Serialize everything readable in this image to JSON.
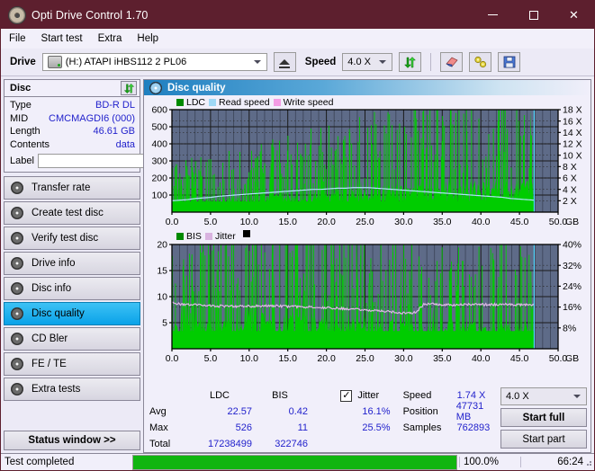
{
  "window": {
    "title": "Opti Drive Control 1.70",
    "icon": "disc-icon",
    "minimize": "minimize-icon",
    "maximize": "maximize-icon",
    "close": "close-icon"
  },
  "menu": {
    "items": [
      "File",
      "Start test",
      "Extra",
      "Help"
    ]
  },
  "toolbar": {
    "drive_label": "Drive",
    "drive_value": "(H:)   ATAPI iHBS112  2 PL06",
    "eject_icon": "eject-icon",
    "speed_label": "Speed",
    "speed_value": "4.0 X",
    "refresh_icon": "refresh-icon",
    "erase_icon": "eraser-icon",
    "tools_icon": "tools-icon",
    "save_icon": "save-icon"
  },
  "disc_panel": {
    "title": "Disc",
    "refresh_icon": "refresh-icon",
    "rows": [
      {
        "key": "Type",
        "value": "BD-R DL"
      },
      {
        "key": "MID",
        "value": "CMCMAGDI6 (000)"
      },
      {
        "key": "Length",
        "value": "46.61 GB"
      },
      {
        "key": "Contents",
        "value": "data"
      }
    ],
    "label_key": "Label",
    "label_value": "",
    "label_placeholder": "",
    "disc_icon": "disc-icon"
  },
  "nav": {
    "items": [
      {
        "label": "Transfer rate",
        "selected": false
      },
      {
        "label": "Create test disc",
        "selected": false
      },
      {
        "label": "Verify test disc",
        "selected": false
      },
      {
        "label": "Drive info",
        "selected": false
      },
      {
        "label": "Disc info",
        "selected": false
      },
      {
        "label": "Disc quality",
        "selected": true
      },
      {
        "label": "CD Bler",
        "selected": false
      },
      {
        "label": "FE / TE",
        "selected": false
      },
      {
        "label": "Extra tests",
        "selected": false
      }
    ],
    "status_window": "Status window >>"
  },
  "panel": {
    "title": "Disc quality",
    "icon": "disc-quality-icon"
  },
  "chart_data": [
    {
      "type": "area",
      "name": "top-chart",
      "title": "",
      "xlabel": "GB",
      "ylabel": "",
      "xlim": [
        0,
        50
      ],
      "ylim": [
        0,
        600
      ],
      "y2lim": [
        0,
        18
      ],
      "xticks": [
        "0.0",
        "5.0",
        "10.0",
        "15.0",
        "20.0",
        "25.0",
        "30.0",
        "35.0",
        "40.0",
        "45.0",
        "50.0"
      ],
      "yticks": [
        "100",
        "200",
        "300",
        "400",
        "500",
        "600"
      ],
      "y2ticks": [
        "2 X",
        "4 X",
        "6 X",
        "8 X",
        "10 X",
        "12 X",
        "14 X",
        "16 X",
        "18 X"
      ],
      "x_unit": "GB",
      "legend": [
        {
          "label": "LDC",
          "color": "#00a000"
        },
        {
          "label": "Read speed",
          "color": "#9fd8f5"
        },
        {
          "label": "Write speed",
          "color": "#f49ce4"
        }
      ],
      "grid": true,
      "plot_bg": "#5e6b88",
      "data_end_x": 46.9,
      "series": [
        {
          "name": "LDC",
          "color": "#00cc00",
          "type": "area-spikes",
          "baseline": [
            60,
            62,
            65,
            68,
            70,
            72,
            74,
            78,
            80,
            82,
            85,
            88,
            90,
            92,
            95,
            98,
            100,
            103,
            106,
            110,
            112,
            115,
            118,
            120,
            122,
            125,
            128,
            130,
            132,
            134,
            136,
            138,
            140,
            142,
            144,
            146,
            148,
            150,
            152,
            154,
            156,
            158,
            160,
            162,
            160,
            158,
            156
          ],
          "max_spike": 526
        },
        {
          "name": "Read speed",
          "color": "#aee4fa",
          "type": "line",
          "values": [
            2.0,
            2.1,
            2.2,
            2.4,
            2.5,
            2.6,
            2.8,
            2.9,
            3.0,
            3.1,
            3.2,
            3.3,
            3.4,
            3.5,
            3.6,
            3.7,
            3.8,
            3.9,
            4.0,
            4.0,
            4.1,
            4.2,
            4.2,
            4.3,
            4.3,
            4.3,
            4.2,
            4.1,
            4.0,
            3.9,
            3.8,
            3.7,
            3.6,
            3.5,
            3.4,
            3.3,
            3.2,
            3.1,
            3.0,
            2.9,
            2.8,
            2.7,
            2.6,
            2.4,
            2.3,
            2.2,
            2.1
          ]
        }
      ],
      "cursor_x": 46.9
    },
    {
      "type": "area",
      "name": "bottom-chart",
      "title": "",
      "xlabel": "GB",
      "xlim": [
        0,
        50
      ],
      "ylim": [
        0,
        20
      ],
      "y2lim": [
        0,
        40
      ],
      "xticks": [
        "0.0",
        "5.0",
        "10.0",
        "15.0",
        "20.0",
        "25.0",
        "30.0",
        "35.0",
        "40.0",
        "45.0",
        "50.0"
      ],
      "yticks": [
        "5",
        "10",
        "15",
        "20"
      ],
      "y2ticks": [
        "8%",
        "16%",
        "24%",
        "32%",
        "40%"
      ],
      "x_unit": "GB",
      "legend": [
        {
          "label": "BIS",
          "color": "#00a000"
        },
        {
          "label": "Jitter",
          "color": "#d9b3e0"
        }
      ],
      "grid": true,
      "plot_bg": "#5e6b88",
      "data_end_x": 46.9,
      "series": [
        {
          "name": "BIS",
          "color": "#00cc00",
          "type": "area-spikes",
          "baseline": [
            4.0,
            4.2,
            4.3,
            4.5,
            4.6,
            4.8,
            5.0,
            5.2,
            5.4,
            5.6,
            5.8,
            5.9,
            6.0,
            6.0,
            6.0,
            6.0,
            6.0,
            5.9,
            5.8,
            5.6,
            5.5,
            5.3,
            5.2,
            5.0,
            5.0,
            5.0,
            4.9,
            4.8,
            4.7,
            4.6,
            4.6,
            4.5,
            4.4,
            4.4,
            4.4,
            4.4,
            4.4,
            4.4,
            4.4,
            4.4,
            4.4,
            4.4,
            4.4,
            4.3,
            4.3,
            4.2,
            4.1
          ],
          "max_spike": 11
        },
        {
          "name": "Jitter",
          "color": "#dcb8e4",
          "type": "line",
          "values": [
            17.6,
            17.2,
            17.0,
            16.8,
            16.6,
            16.5,
            16.4,
            16.4,
            16.3,
            16.3,
            16.3,
            16.4,
            16.4,
            16.4,
            16.3,
            16.2,
            16.1,
            16.0,
            15.9,
            15.8,
            15.7,
            15.6,
            15.4,
            15.2,
            15.0,
            14.8,
            14.6,
            14.4,
            14.2,
            13.8,
            13.6,
            14.0,
            17.0,
            17.2,
            16.9,
            16.8,
            16.8,
            16.9,
            17.0,
            17.0,
            16.9,
            16.9,
            17.0,
            17.0,
            16.9,
            16.9,
            16.8
          ]
        }
      ],
      "cursor_x": 46.9
    }
  ],
  "stats": {
    "col_headers": [
      "LDC",
      "BIS"
    ],
    "rows": [
      {
        "label": "Avg",
        "ldc": "22.57",
        "bis": "0.42"
      },
      {
        "label": "Max",
        "ldc": "526",
        "bis": "11"
      },
      {
        "label": "Total",
        "ldc": "17238499",
        "bis": "322746"
      }
    ],
    "jitter": {
      "checked": true,
      "label": "Jitter",
      "avg": "16.1%",
      "max": "25.5%"
    },
    "speed_label": "Speed",
    "speed_value": "1.74 X",
    "position_label": "Position",
    "position_value": "47731 MB",
    "samples_label": "Samples",
    "samples_value": "762893",
    "speed_select": "4.0 X",
    "start_full": "Start full",
    "start_part": "Start part"
  },
  "statusbar": {
    "message": "Test completed",
    "progress_percent": 100,
    "progress_text": "100.0%",
    "elapsed": "66:24"
  },
  "colors": {
    "titlebar": "#5d1f2e",
    "accent": "#2222cc",
    "selected_nav": "#0aa2e8",
    "progress": "#10b510",
    "plot_bg": "#5e6b88",
    "ldc_green": "#00cc00",
    "read_speed": "#aee4fa",
    "jitter": "#dcb8e4",
    "write_speed": "#f49ce4"
  }
}
